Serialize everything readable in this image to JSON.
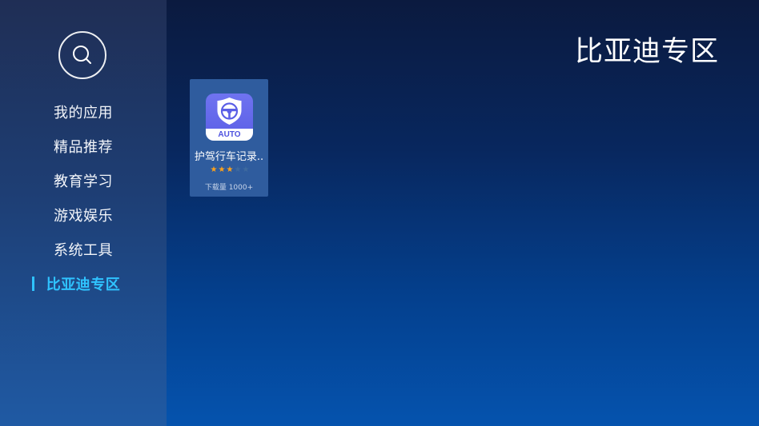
{
  "sidebar": {
    "search_icon": "search-icon",
    "items": [
      {
        "label": "我的应用",
        "active": false
      },
      {
        "label": "精品推荐",
        "active": false
      },
      {
        "label": "教育学习",
        "active": false
      },
      {
        "label": "游戏娱乐",
        "active": false
      },
      {
        "label": "系统工具",
        "active": false
      },
      {
        "label": "比亚迪专区",
        "active": true
      }
    ]
  },
  "header": {
    "title": "比亚迪专区"
  },
  "apps": [
    {
      "name": "护驾行车记录..",
      "icon_label": "AUTO",
      "rating": 3,
      "rating_max": 5,
      "downloads": "下载量 1000+"
    }
  ],
  "colors": {
    "accent": "#2fc3ff",
    "star_on": "#ffa21a",
    "star_off": "#3e6a9f",
    "icon_bg": "#5b5fe6"
  }
}
